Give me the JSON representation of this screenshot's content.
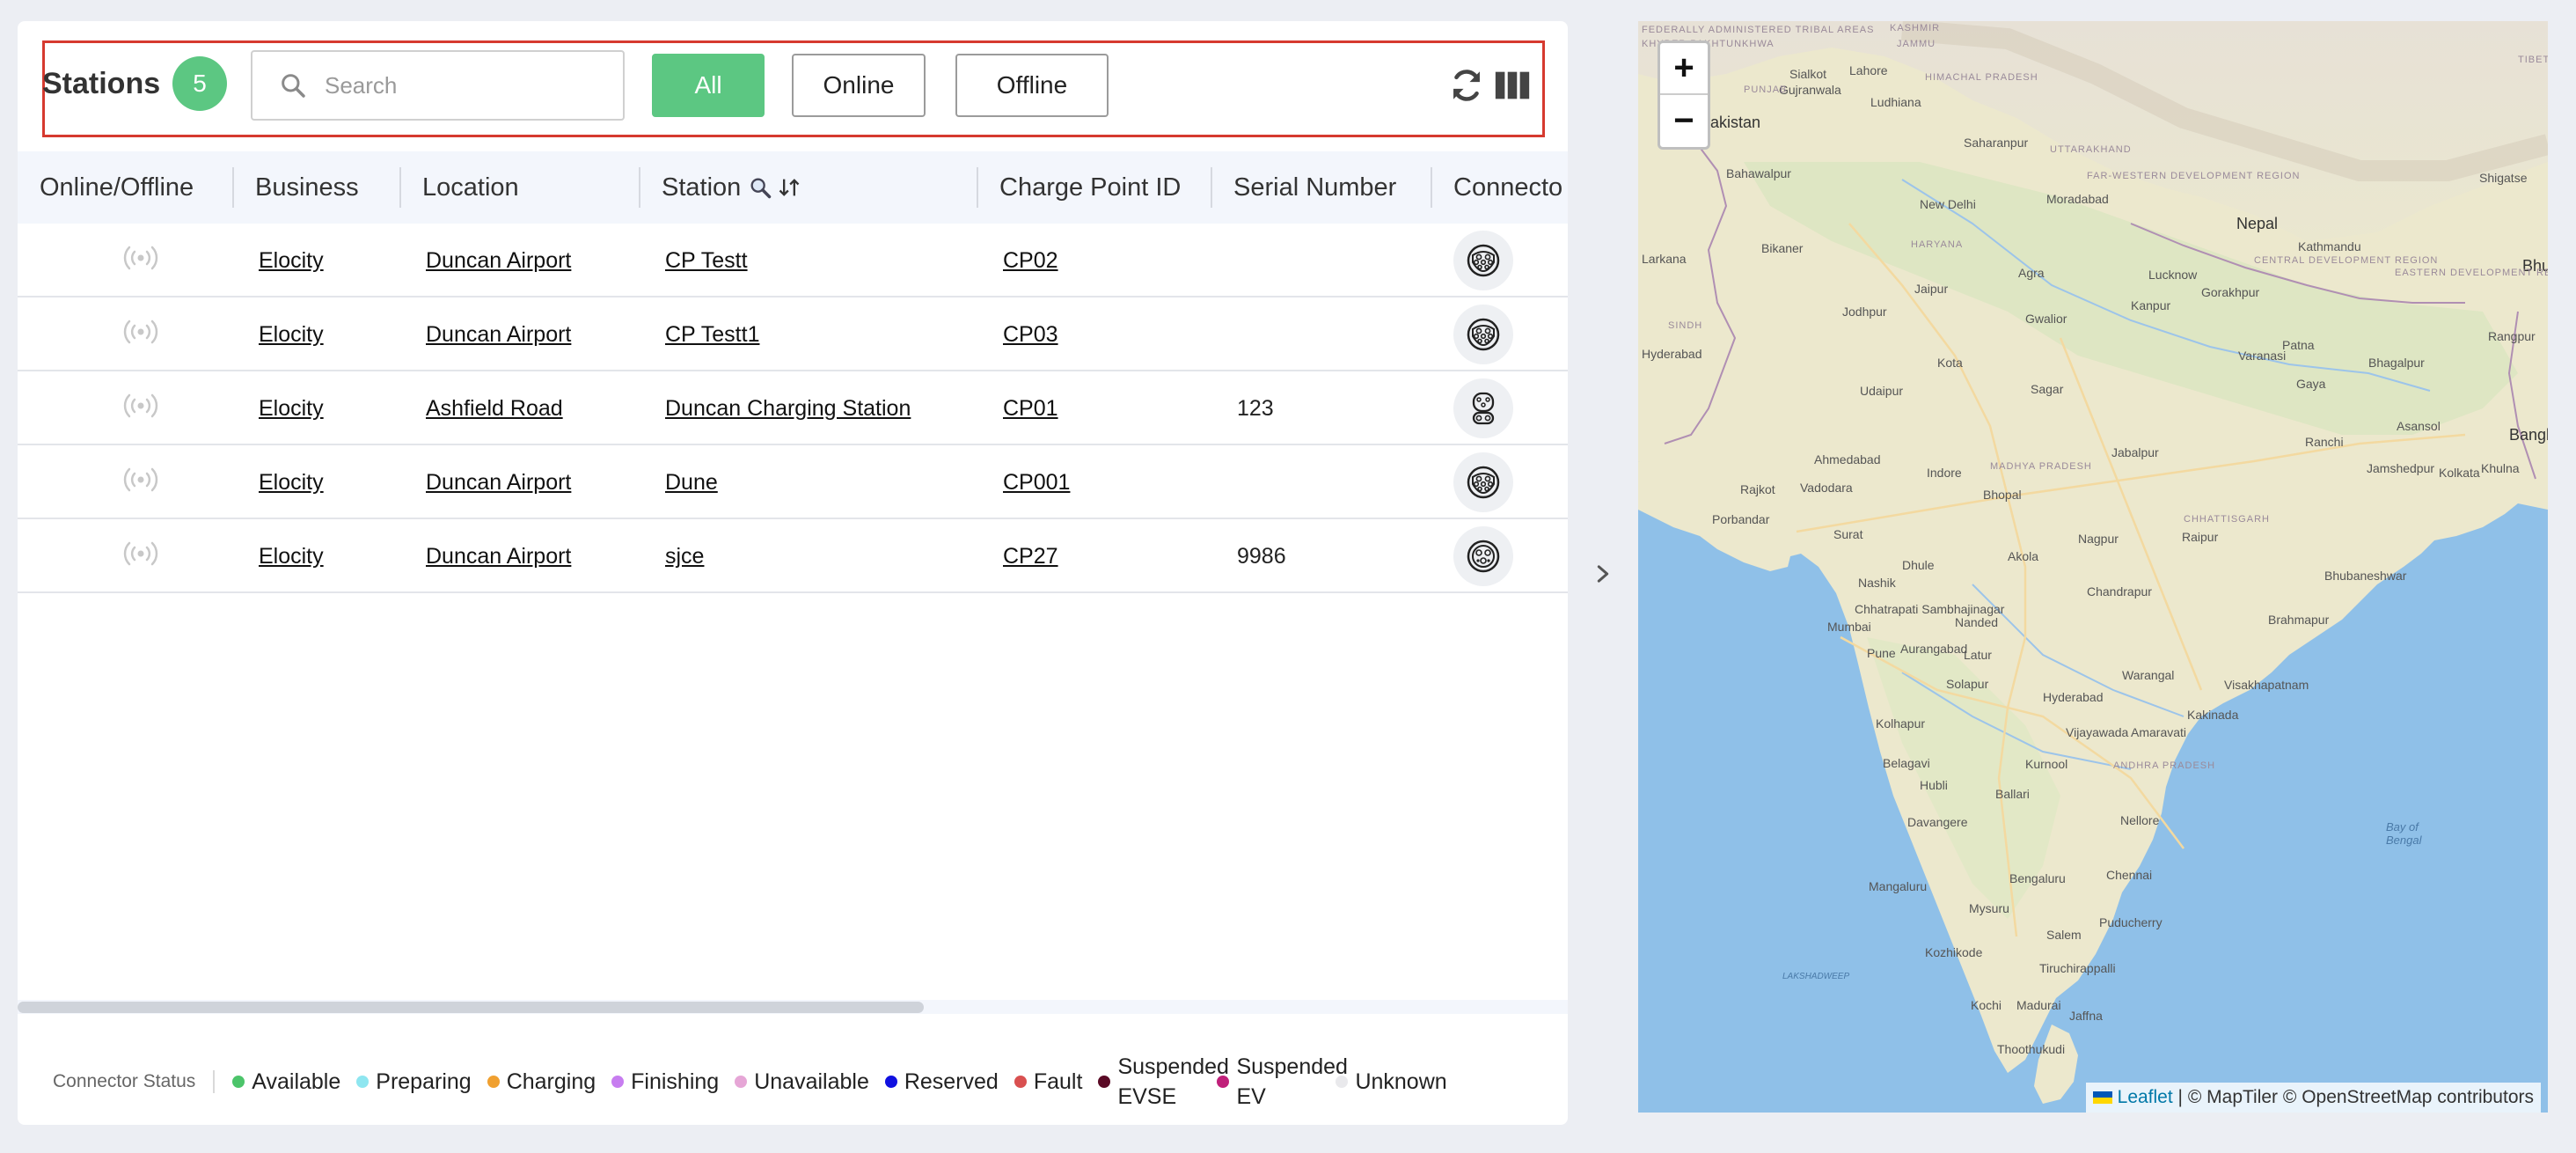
{
  "header": {
    "title": "Stations",
    "count": "5",
    "search_placeholder": "Search",
    "filters": {
      "all": "All",
      "online": "Online",
      "offline": "Offline"
    },
    "active_filter": "All"
  },
  "columns": [
    "Online/Offline",
    "Business",
    "Location",
    "Station",
    "Charge Point ID",
    "Serial Number",
    "Connecto"
  ],
  "rows": [
    {
      "status_icon": "wifi-signal-icon",
      "business": "Elocity",
      "location": "Duncan Airport",
      "station": "CP Testt",
      "charge_point_id": "CP02",
      "serial_number": "",
      "connector_icon": "type2-connector-icon"
    },
    {
      "status_icon": "wifi-signal-icon",
      "business": "Elocity",
      "location": "Duncan Airport",
      "station": "CP Testt1",
      "charge_point_id": "CP03",
      "serial_number": "",
      "connector_icon": "type2-connector-icon"
    },
    {
      "status_icon": "wifi-signal-icon",
      "business": "Elocity",
      "location": "Ashfield Road",
      "station": "Duncan Charging Station",
      "charge_point_id": "CP01",
      "serial_number": "123",
      "connector_icon": "ccs-connector-icon"
    },
    {
      "status_icon": "wifi-signal-icon",
      "business": "Elocity",
      "location": "Duncan Airport",
      "station": "Dune",
      "charge_point_id": "CP001",
      "serial_number": "",
      "connector_icon": "type2-connector-icon"
    },
    {
      "status_icon": "wifi-signal-icon",
      "business": "Elocity",
      "location": "Duncan Airport",
      "station": "sjce",
      "charge_point_id": "CP27",
      "serial_number": "9986",
      "connector_icon": "type1-connector-icon"
    }
  ],
  "legend": {
    "title": "Connector Status",
    "items": [
      {
        "label": "Available",
        "color": "#4cc46a"
      },
      {
        "label": "Preparing",
        "color": "#8ee6f0"
      },
      {
        "label": "Charging",
        "color": "#f0a030"
      },
      {
        "label": "Finishing",
        "color": "#c77df0"
      },
      {
        "label": "Unavailable",
        "color": "#e6a6d6"
      },
      {
        "label": "Reserved",
        "color": "#1010e0"
      },
      {
        "label": "Fault",
        "color": "#d95050"
      },
      {
        "label": "Suspended EVSE",
        "color": "#5a0a25"
      },
      {
        "label": "Suspended EV",
        "color": "#c0207a"
      },
      {
        "label": "Unknown",
        "color": "#e9e9ec"
      }
    ]
  },
  "map": {
    "zoom_in": "+",
    "zoom_out": "−",
    "attribution_leaflet": "Leaflet",
    "attribution_rest": "| © MapTiler © OpenStreetMap contributors",
    "labels": {
      "pakistan": "Pakistan",
      "nepal": "Nepal",
      "bangladesh": "Banglad",
      "bhutan": "Bhu",
      "new_delhi": "New Delhi",
      "lahore": "Lahore",
      "kathmandu": "Kathmandu",
      "mumbai": "Mumbai",
      "bengaluru": "Bengaluru",
      "chennai": "Chennai",
      "hyderabad": "Hyderabad",
      "nagpur": "Nagpur",
      "kolkata": "Kolkata",
      "ahmedabad": "Ahmedabad",
      "jaipur": "Jaipur",
      "pune": "Pune",
      "bhopal": "Bhopal",
      "kanpur": "Kanpur",
      "patna": "Patna",
      "varanasi": "Varanasi",
      "agra": "Agra",
      "surat": "Surat",
      "indore": "Indore",
      "raipur": "Raipur",
      "bhubaneshwar": "Bhubaneshwar",
      "visakhapatnam": "Visakhapatnam",
      "vijayawada": "Vijayawada",
      "kochi": "Kochi",
      "madurai": "Madurai",
      "mangaluru": "Mangaluru",
      "tibet": "TIBET",
      "bay_of_bengal": "Bay of Bengal",
      "lakshadweep": "LAKSHADWEEP",
      "jammu": "JAMMU",
      "kashmir": "KASHMIR",
      "punjab": "PUNJAB",
      "haryana": "HARYANA",
      "uttarakhand": "UTTARAKHAND",
      "larkana": "Larkana",
      "bahawalpur": "Bahawalpur",
      "jodhpur": "Jodhpur",
      "udaipur": "Udaipur",
      "kota": "Kota",
      "gwalior": "Gwalior",
      "lucknow": "Lucknow",
      "ludhiana": "Ludhiana",
      "moradabad": "Moradabad",
      "saharanpur": "Saharanpur",
      "gorakhpur": "Gorakhpur",
      "gaya": "Gaya",
      "ranchi": "Ranchi",
      "jamshedpur": "Jamshedpur",
      "asansol": "Asansol",
      "bhagalpur": "Bhagalpur",
      "jabalpur": "Jabalpur",
      "vadodara": "Vadodara",
      "rajkot": "Rajkot",
      "porbandar": "Porbandar",
      "nashik": "Nashik",
      "aurangabad": "Aurangabad",
      "akola": "Akola",
      "dhule": "Dhule",
      "nanded": "Nanded",
      "latur": "Latur",
      "solapur": "Solapur",
      "kolhapur": "Kolhapur",
      "belagavi": "Belagavi",
      "hubli": "Hubli",
      "davangere": "Davangere",
      "ballari": "Ballari",
      "kurnool": "Kurnool",
      "nellore": "Nellore",
      "mysuru": "Mysuru",
      "salem": "Salem",
      "kozhikode": "Kozhikode",
      "tiruchirappalli": "Tiruchirappalli",
      "puducherry": "Puducherry",
      "thoothukudi": "Thoothukudi",
      "jaffna": "Jaffna",
      "brahmapur": "Brahmapur",
      "warangal": "Warangal",
      "kakinada": "Kakinada",
      "amaravati": "Amaravati",
      "chandrapur": "Chandrapur",
      "sagar": "Sagar",
      "bikaner": "Bikaner",
      "hyderabad_pk": "Hyderabad",
      "sialkot": "Sialkot",
      "gujranwala": "Gujranwala",
      "shigatse": "Shigatse",
      "khulna": "Khulna",
      "rangpur": "Rangpur",
      "himachal": "HIMACHAL PRADESH",
      "madhya_pradesh": "MADHYA PRADESH",
      "chhattisgarh": "CHHATTISGARH",
      "andhra_pradesh": "ANDHRA PRADESH",
      "far_west": "FAR-WESTERN DEVELOPMENT REGION",
      "eastern_dev": "EASTERN DEVELOPMENT REGION",
      "central_dev": "CENTRAL DEVELOPMENT REGION",
      "chhatrapati": "Chhatrapati Sambhajinagar",
      "sindh": "SINDH",
      "fata": "FEDERALLY ADMINISTERED TRIBAL AREAS",
      "kpk": "KHYBER PAKHTUNKHWA"
    }
  }
}
